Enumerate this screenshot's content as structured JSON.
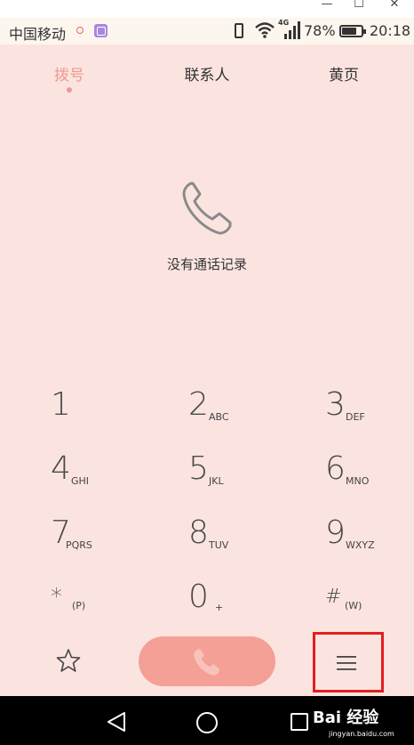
{
  "status_bar": {
    "carrier": "中国移动",
    "network_type": "4G",
    "battery_percent": "78%",
    "battery_level": 0.78,
    "time": "20:18"
  },
  "tabs": [
    {
      "label": "拨号",
      "active": true
    },
    {
      "label": "联系人",
      "active": false
    },
    {
      "label": "黄页",
      "active": false
    }
  ],
  "empty_state": {
    "icon": "phone-icon",
    "text": "没有通话记录"
  },
  "dialpad": {
    "keys": [
      {
        "digit": "1",
        "letters": ""
      },
      {
        "digit": "2",
        "letters": "ABC"
      },
      {
        "digit": "3",
        "letters": "DEF"
      },
      {
        "digit": "4",
        "letters": "GHI"
      },
      {
        "digit": "5",
        "letters": "JKL"
      },
      {
        "digit": "6",
        "letters": "MNO"
      },
      {
        "digit": "7",
        "letters": "PQRS"
      },
      {
        "digit": "8",
        "letters": "TUV"
      },
      {
        "digit": "9",
        "letters": "WXYZ"
      },
      {
        "digit": "*",
        "letters": "(P)"
      },
      {
        "digit": "0",
        "letters": "+"
      },
      {
        "digit": "#",
        "letters": "(W)"
      }
    ]
  },
  "actions": {
    "favorites_icon": "star-icon",
    "call_icon": "phone-icon",
    "menu_icon": "menu-icon"
  },
  "nav_bar": {
    "back_icon": "back-triangle-icon",
    "home_icon": "home-circle-icon",
    "recent_icon": "recent-square-icon"
  },
  "watermark": {
    "text": "Bai 经验",
    "sub": "jingyan.baidu.com"
  },
  "colors": {
    "background": "#fbe4e0",
    "accent": "#f0998f",
    "call_button": "#f4a096",
    "highlight_box": "#e02020"
  }
}
